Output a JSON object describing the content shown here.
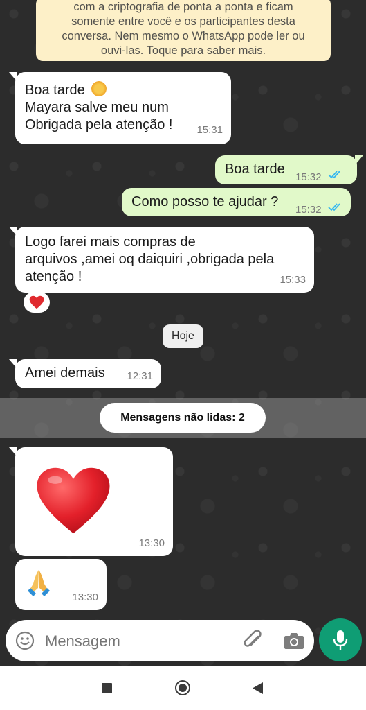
{
  "encryption_notice": {
    "line1": "com a criptografia de ponta a ponta e ficam",
    "line2": "somente entre você e os participantes desta",
    "line3": "conversa. Nem mesmo o WhatsApp pode ler ou",
    "line4": "ouvi-las. Toque para saber mais."
  },
  "messages": [
    {
      "line1": "Boa tarde",
      "line2": "Mayara salve meu num",
      "line3": "Obrigada pela atenção !",
      "time": "15:31"
    },
    {
      "text": "Boa tarde",
      "time": "15:32"
    },
    {
      "text": "Como posso te ajudar ?",
      "time": "15:32"
    },
    {
      "line1": "Logo farei mais compras de",
      "line2": "arquivos ,amei oq daiquiri ,obrigada pela",
      "line3": "atenção !",
      "time": "15:33"
    },
    {
      "text": "Amei demais",
      "time": "12:31"
    },
    {
      "time": "13:30"
    },
    {
      "time": "13:30"
    }
  ],
  "date_chip": "Hoje",
  "unread_label": "Mensagens não lidas: 2",
  "input": {
    "placeholder": "Mensagem"
  },
  "colors": {
    "outgoing": "#e1f9c9",
    "incoming": "#ffffff",
    "accent": "#0f9d74",
    "read_ticks": "#34b7f1"
  },
  "icons": [
    "sun-emoji-icon",
    "double-check-icon",
    "heart-reaction-icon",
    "heart-emoji-icon",
    "praying-hands-emoji-icon",
    "emoji-icon",
    "attach-icon",
    "camera-icon",
    "mic-icon",
    "nav-recents-icon",
    "nav-home-icon",
    "nav-back-icon"
  ]
}
